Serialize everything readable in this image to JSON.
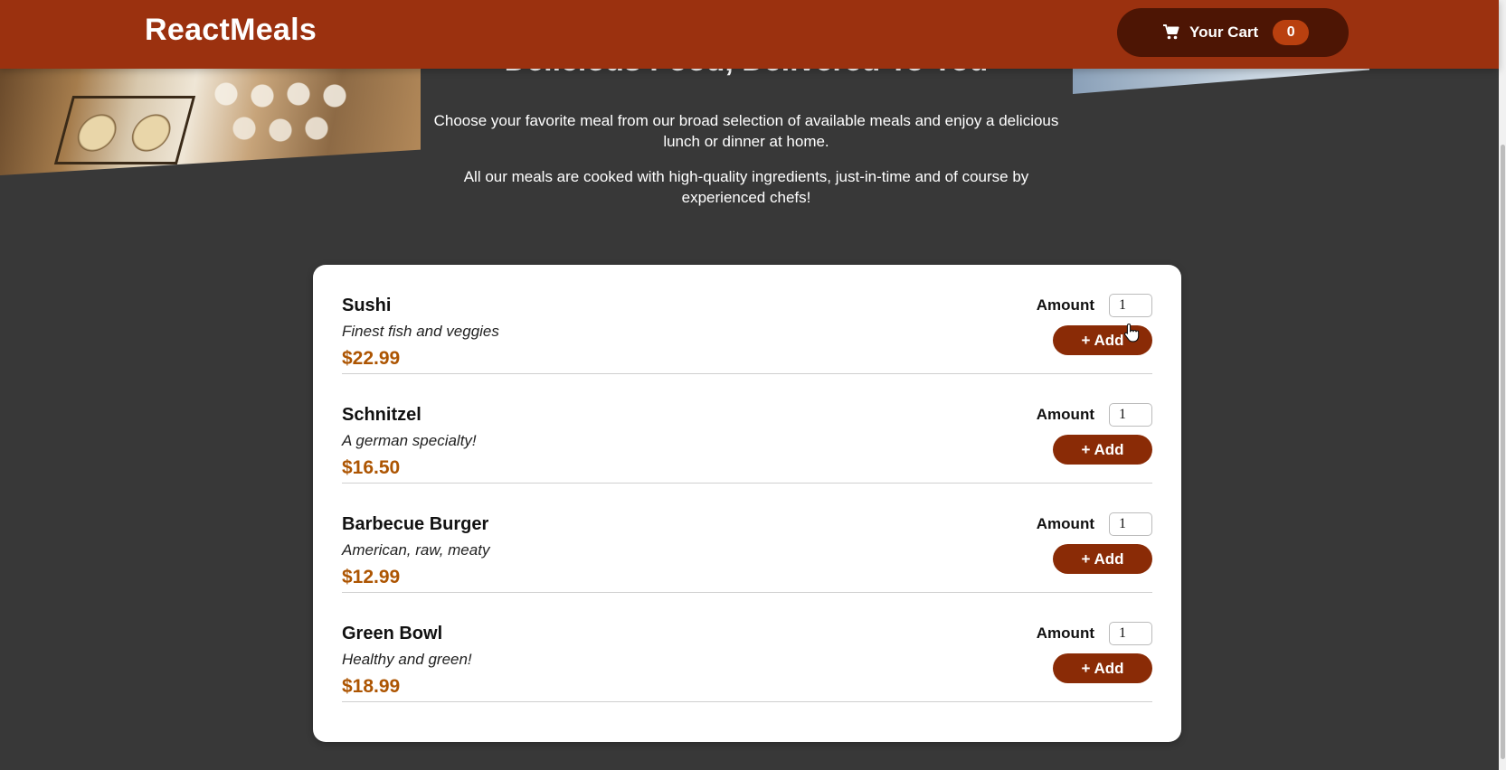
{
  "header": {
    "logo": "ReactMeals",
    "cart_label": "Your Cart",
    "cart_count": "0"
  },
  "summary": {
    "title": "Delicious Food, Delivered To You",
    "paragraph1": "Choose your favorite meal from our broad selection of available meals and enjoy a delicious lunch or dinner at home.",
    "paragraph2": "All our meals are cooked with high-quality ingredients, just-in-time and of course by experienced chefs!"
  },
  "meals": [
    {
      "name": "Sushi",
      "description": "Finest fish and veggies",
      "price": "$22.99",
      "amount_label": "Amount",
      "amount_value": "1",
      "add_label": "+ Add"
    },
    {
      "name": "Schnitzel",
      "description": "A german specialty!",
      "price": "$16.50",
      "amount_label": "Amount",
      "amount_value": "1",
      "add_label": "+ Add"
    },
    {
      "name": "Barbecue Burger",
      "description": "American, raw, meaty",
      "price": "$12.99",
      "amount_label": "Amount",
      "amount_value": "1",
      "add_label": "+ Add"
    },
    {
      "name": "Green Bowl",
      "description": "Healthy and green!",
      "price": "$18.99",
      "amount_label": "Amount",
      "amount_value": "1",
      "add_label": "+ Add"
    }
  ],
  "colors": {
    "header_bg": "#9b310f",
    "page_bg": "#383838",
    "cart_button_bg": "#4d1504",
    "badge_bg": "#b9400f",
    "price": "#ad5502",
    "add_button_bg": "#8a2b06"
  },
  "icons": {
    "cart": "shopping-cart-icon"
  }
}
